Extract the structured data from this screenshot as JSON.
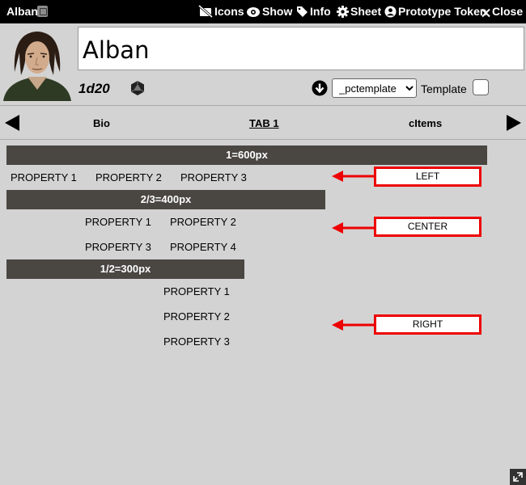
{
  "window": {
    "title": "Alban",
    "header_buttons": [
      {
        "label": "Icons",
        "icon": "icons-slash-icon"
      },
      {
        "label": "Show",
        "icon": "eye-icon"
      },
      {
        "label": "Info",
        "icon": "tag-icon"
      },
      {
        "label": "Sheet",
        "icon": "gear-icon"
      },
      {
        "label": "Prototype Token",
        "icon": "user-circle-icon"
      },
      {
        "label": "Close",
        "icon": "close-icon"
      }
    ]
  },
  "character": {
    "name": "Alban",
    "die": "1d20"
  },
  "template": {
    "selected": "_pctemplate",
    "label": "Template",
    "checked": false
  },
  "tabs": [
    {
      "label": "Bio",
      "active": false
    },
    {
      "label": "TAB 1",
      "active": true
    },
    {
      "label": "cItems",
      "active": false
    }
  ],
  "sections": [
    {
      "header": "1=600px",
      "properties": [
        "PROPERTY 1",
        "PROPERTY 2",
        "PROPERTY 3"
      ]
    },
    {
      "header": "2/3=400px",
      "properties": [
        "PROPERTY 1",
        "PROPERTY 2",
        "PROPERTY 3",
        "PROPERTY 4"
      ]
    },
    {
      "header": "1/2=300px",
      "properties": [
        "PROPERTY 1",
        "PROPERTY 2",
        "PROPERTY 3"
      ]
    }
  ],
  "annotations": [
    "LEFT",
    "CENTER",
    "RIGHT"
  ],
  "colors": {
    "title_bar": "#000000",
    "background": "#d3d3d3",
    "section_header": "#4a4743",
    "annotation": "#ee0000"
  }
}
